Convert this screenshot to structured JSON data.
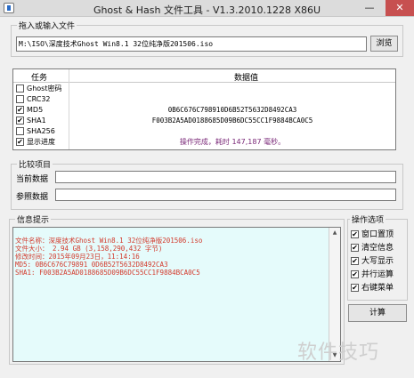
{
  "window": {
    "title": "Ghost & Hash 文件工具 - V1.3.2010.1228 X86U",
    "minimize_glyph": "—",
    "close_glyph": "✕"
  },
  "input_section": {
    "label": "拖入或输入文件",
    "path_value": "M:\\ISO\\深度技术Ghost Win8.1 32位纯净版201506.iso",
    "browse_label": "浏览"
  },
  "task_table": {
    "headers": {
      "task": "任务",
      "value": "数据值"
    },
    "rows": [
      {
        "task": "Ghost密码",
        "checked": false,
        "value": ""
      },
      {
        "task": "CRC32",
        "checked": false,
        "value": ""
      },
      {
        "task": "MD5",
        "checked": true,
        "value": "0B6C676C798910D6B52T5632D8492CA3"
      },
      {
        "task": "SHA1",
        "checked": true,
        "value": "F003B2A5AD0188685D09B6DC55CC1F9884BCA0C5"
      },
      {
        "task": "SHA256",
        "checked": false,
        "value": ""
      },
      {
        "task": "显示进度",
        "checked": true,
        "value": "操作完成，耗时 147,187 毫秒。"
      }
    ]
  },
  "compare_section": {
    "label": "比较项目",
    "current_label": "当前数据",
    "reference_label": "参照数据"
  },
  "info_section": {
    "label": "信息提示",
    "lines": [
      "文件名称：深度技术Ghost Win8.1 32位纯净版201506.iso",
      "文件大小： 2.94 GB (3,158,290,432 字节)",
      "修改时间：2015年09月23日，11:14:16",
      "MD5:  0B6C676C79891 0D6B52T5632D8492CA3",
      "SHA1:  F003B2A5AD0188685D09B6DC55CC1F9884BCA0C5"
    ]
  },
  "options": {
    "label": "操作选项",
    "items": [
      {
        "label": "窗口置顶",
        "checked": true
      },
      {
        "label": "清空信息",
        "checked": true
      },
      {
        "label": "大写显示",
        "checked": true
      },
      {
        "label": "并行运算",
        "checked": true
      },
      {
        "label": "右键菜单",
        "checked": true
      }
    ],
    "compute_label": "计算"
  },
  "watermark": "软件技巧"
}
